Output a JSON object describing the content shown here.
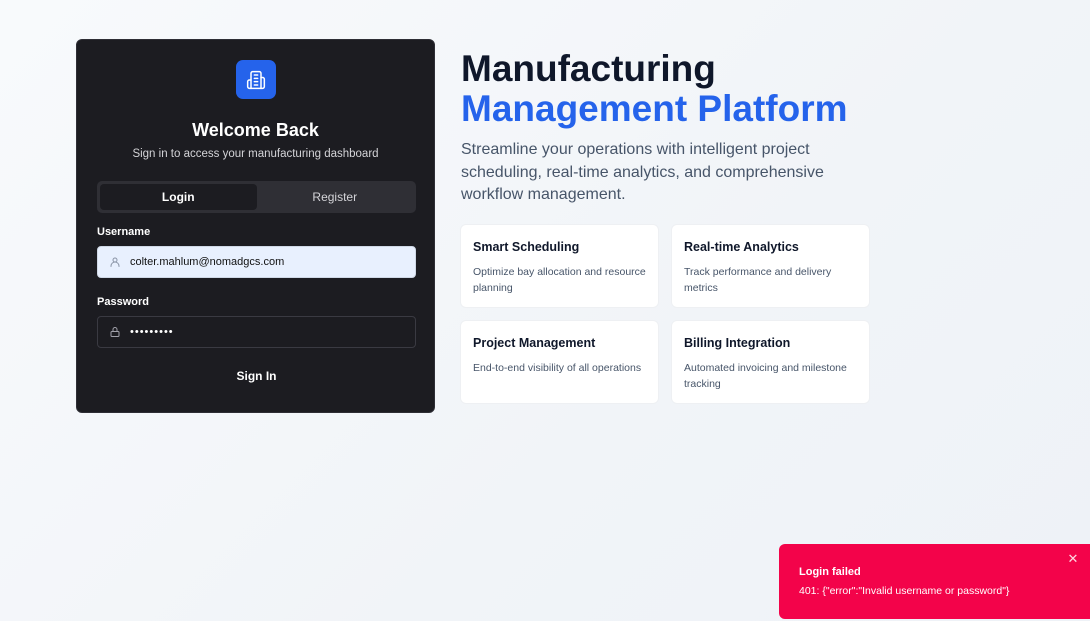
{
  "login_card": {
    "title": "Welcome Back",
    "subtitle": "Sign in to access your manufacturing dashboard",
    "logo_icon": "building-icon",
    "tabs": [
      {
        "label": "Login",
        "active": true
      },
      {
        "label": "Register",
        "active": false
      }
    ],
    "username": {
      "label": "Username",
      "value": "colter.mahlum@nomadgcs.com",
      "icon": "user-icon"
    },
    "password": {
      "label": "Password",
      "value": "•••••••••",
      "icon": "lock-icon"
    },
    "submit_label": "Sign In"
  },
  "hero": {
    "title_line1": "Manufacturing",
    "title_line2": "Management Platform",
    "description": "Streamline your operations with intelligent project scheduling, real-time analytics, and comprehensive workflow management."
  },
  "features": [
    {
      "title": "Smart Scheduling",
      "description": "Optimize bay allocation and resource planning"
    },
    {
      "title": "Real-time Analytics",
      "description": "Track performance and delivery metrics"
    },
    {
      "title": "Project Management",
      "description": "End-to-end visibility of all operations"
    },
    {
      "title": "Billing Integration",
      "description": "Automated invoicing and milestone tracking"
    }
  ],
  "toast": {
    "title": "Login failed",
    "message": "401: {\"error\":\"Invalid username or password\"}",
    "close_icon": "close-icon"
  },
  "colors": {
    "accent": "#2563eb",
    "card_bg": "#1c1c21",
    "toast_bg": "#f3034a"
  }
}
